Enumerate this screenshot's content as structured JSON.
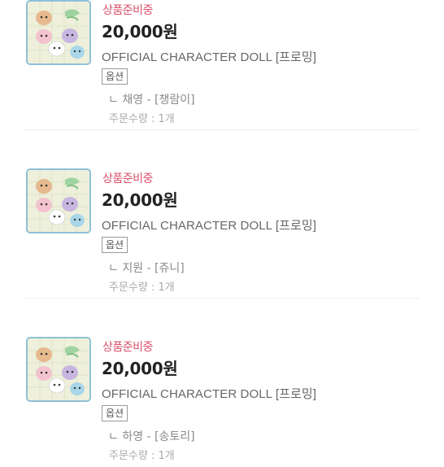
{
  "orders": [
    {
      "status": "상품준비중",
      "price": "20,000원",
      "product_name": "OFFICIAL CHARACTER DOLL [프로밍]",
      "option_label": "옵션",
      "option_value": "ㄴ 채영 - [챙람이]",
      "quantity": "주문수량 : 1개"
    },
    {
      "status": "상품준비중",
      "price": "20,000원",
      "product_name": "OFFICIAL CHARACTER DOLL [프로밍]",
      "option_label": "옵션",
      "option_value": "ㄴ 지원 - [쥬니]",
      "quantity": "주문수량 : 1개"
    },
    {
      "status": "상품준비중",
      "price": "20,000원",
      "product_name": "OFFICIAL CHARACTER DOLL [프로밍]",
      "option_label": "옵션",
      "option_value": "ㄴ 하영 - [송토리]",
      "quantity": "주문수량 : 1개"
    }
  ],
  "colors": {
    "status": "#d9506a",
    "thumb_border": "#8ec1d8",
    "divider": "#eeeeee"
  }
}
